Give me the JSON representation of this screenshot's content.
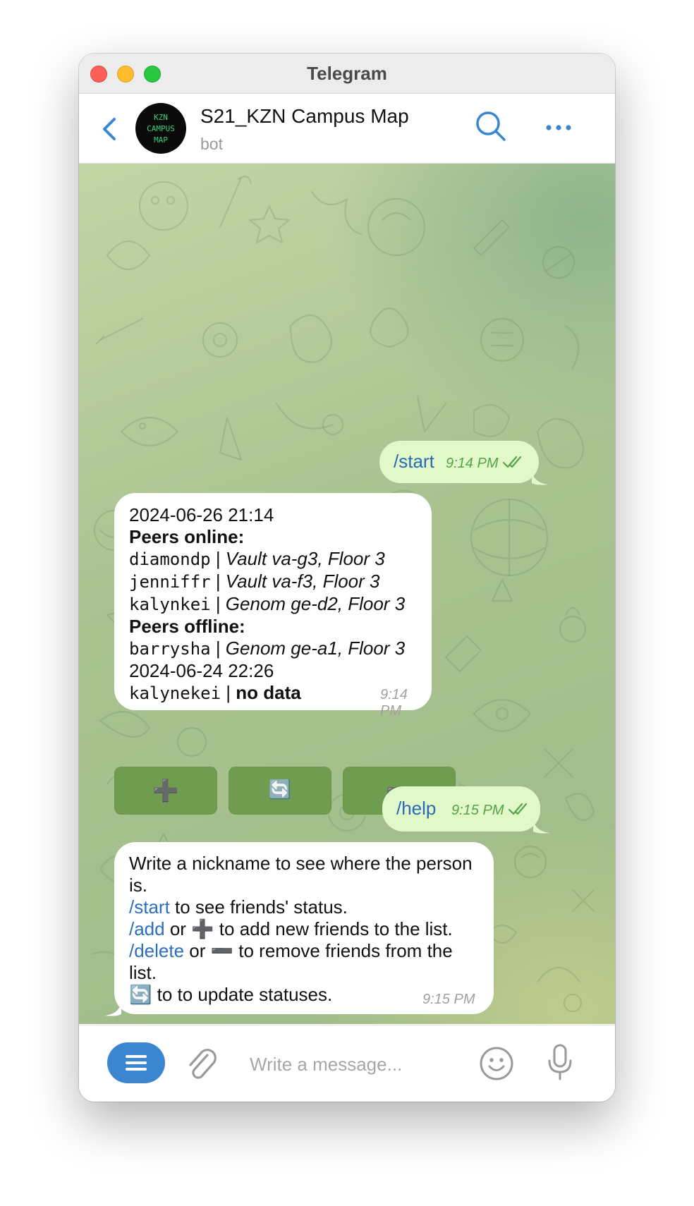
{
  "window": {
    "title": "Telegram"
  },
  "header": {
    "avatar_lines": [
      "KZN",
      "CAMPUS",
      "MAP"
    ],
    "chat_name": "S21_KZN Campus Map",
    "chat_subtitle": "bot"
  },
  "messages": {
    "start": {
      "text": "/start",
      "time": "9:14 PM",
      "status": "read"
    },
    "status_report": {
      "date": "2024-06-26 21:14",
      "online_header": "Peers online:",
      "online": [
        {
          "nick": "diamondp",
          "sep": " | ",
          "location": "Vault va-g3, Floor 3"
        },
        {
          "nick": "jenniffr",
          "sep": " | ",
          "location": "Vault va-f3, Floor 3"
        },
        {
          "nick": "kalynkei",
          "sep": " | ",
          "location": "Genom ge-d2, Floor 3"
        }
      ],
      "offline_header": "Peers offline:",
      "offline": [
        {
          "nick": "barrysha",
          "sep": " | ",
          "location": "Genom ge-a1, Floor 3"
        }
      ],
      "last_seen": "2024-06-24 22:26",
      "nodata_nick": "kalynekei",
      "nodata_sep": " | ",
      "nodata_text": "no data",
      "time": "9:14 PM"
    },
    "keyboard": {
      "add": "➕",
      "refresh": "🔄",
      "remove": "➖"
    },
    "help": {
      "text": "/help",
      "time": "9:15 PM",
      "status": "read"
    },
    "help_reply": {
      "line1": "Write a nickname to see where the person is.",
      "start_cmd": "/start",
      "start_desc": " to see friends' status.",
      "add_cmd": "/add",
      "or1": " or ",
      "add_glyph": "➕",
      "add_desc": " to add new friends to the list.",
      "delete_cmd": "/delete",
      "or2": " or ",
      "delete_glyph": "➖",
      "delete_desc": " to remove friends from the list.",
      "refresh_glyph": "🔄",
      "refresh_desc": " to to update statuses.",
      "time": "9:15 PM"
    }
  },
  "composer": {
    "placeholder": "Write a message..."
  },
  "colors": {
    "accent": "#3c86d0",
    "outgoing_bubble": "#e1f8c9",
    "read_check": "#55a448",
    "keyboard_button": "#6b9a4a"
  }
}
